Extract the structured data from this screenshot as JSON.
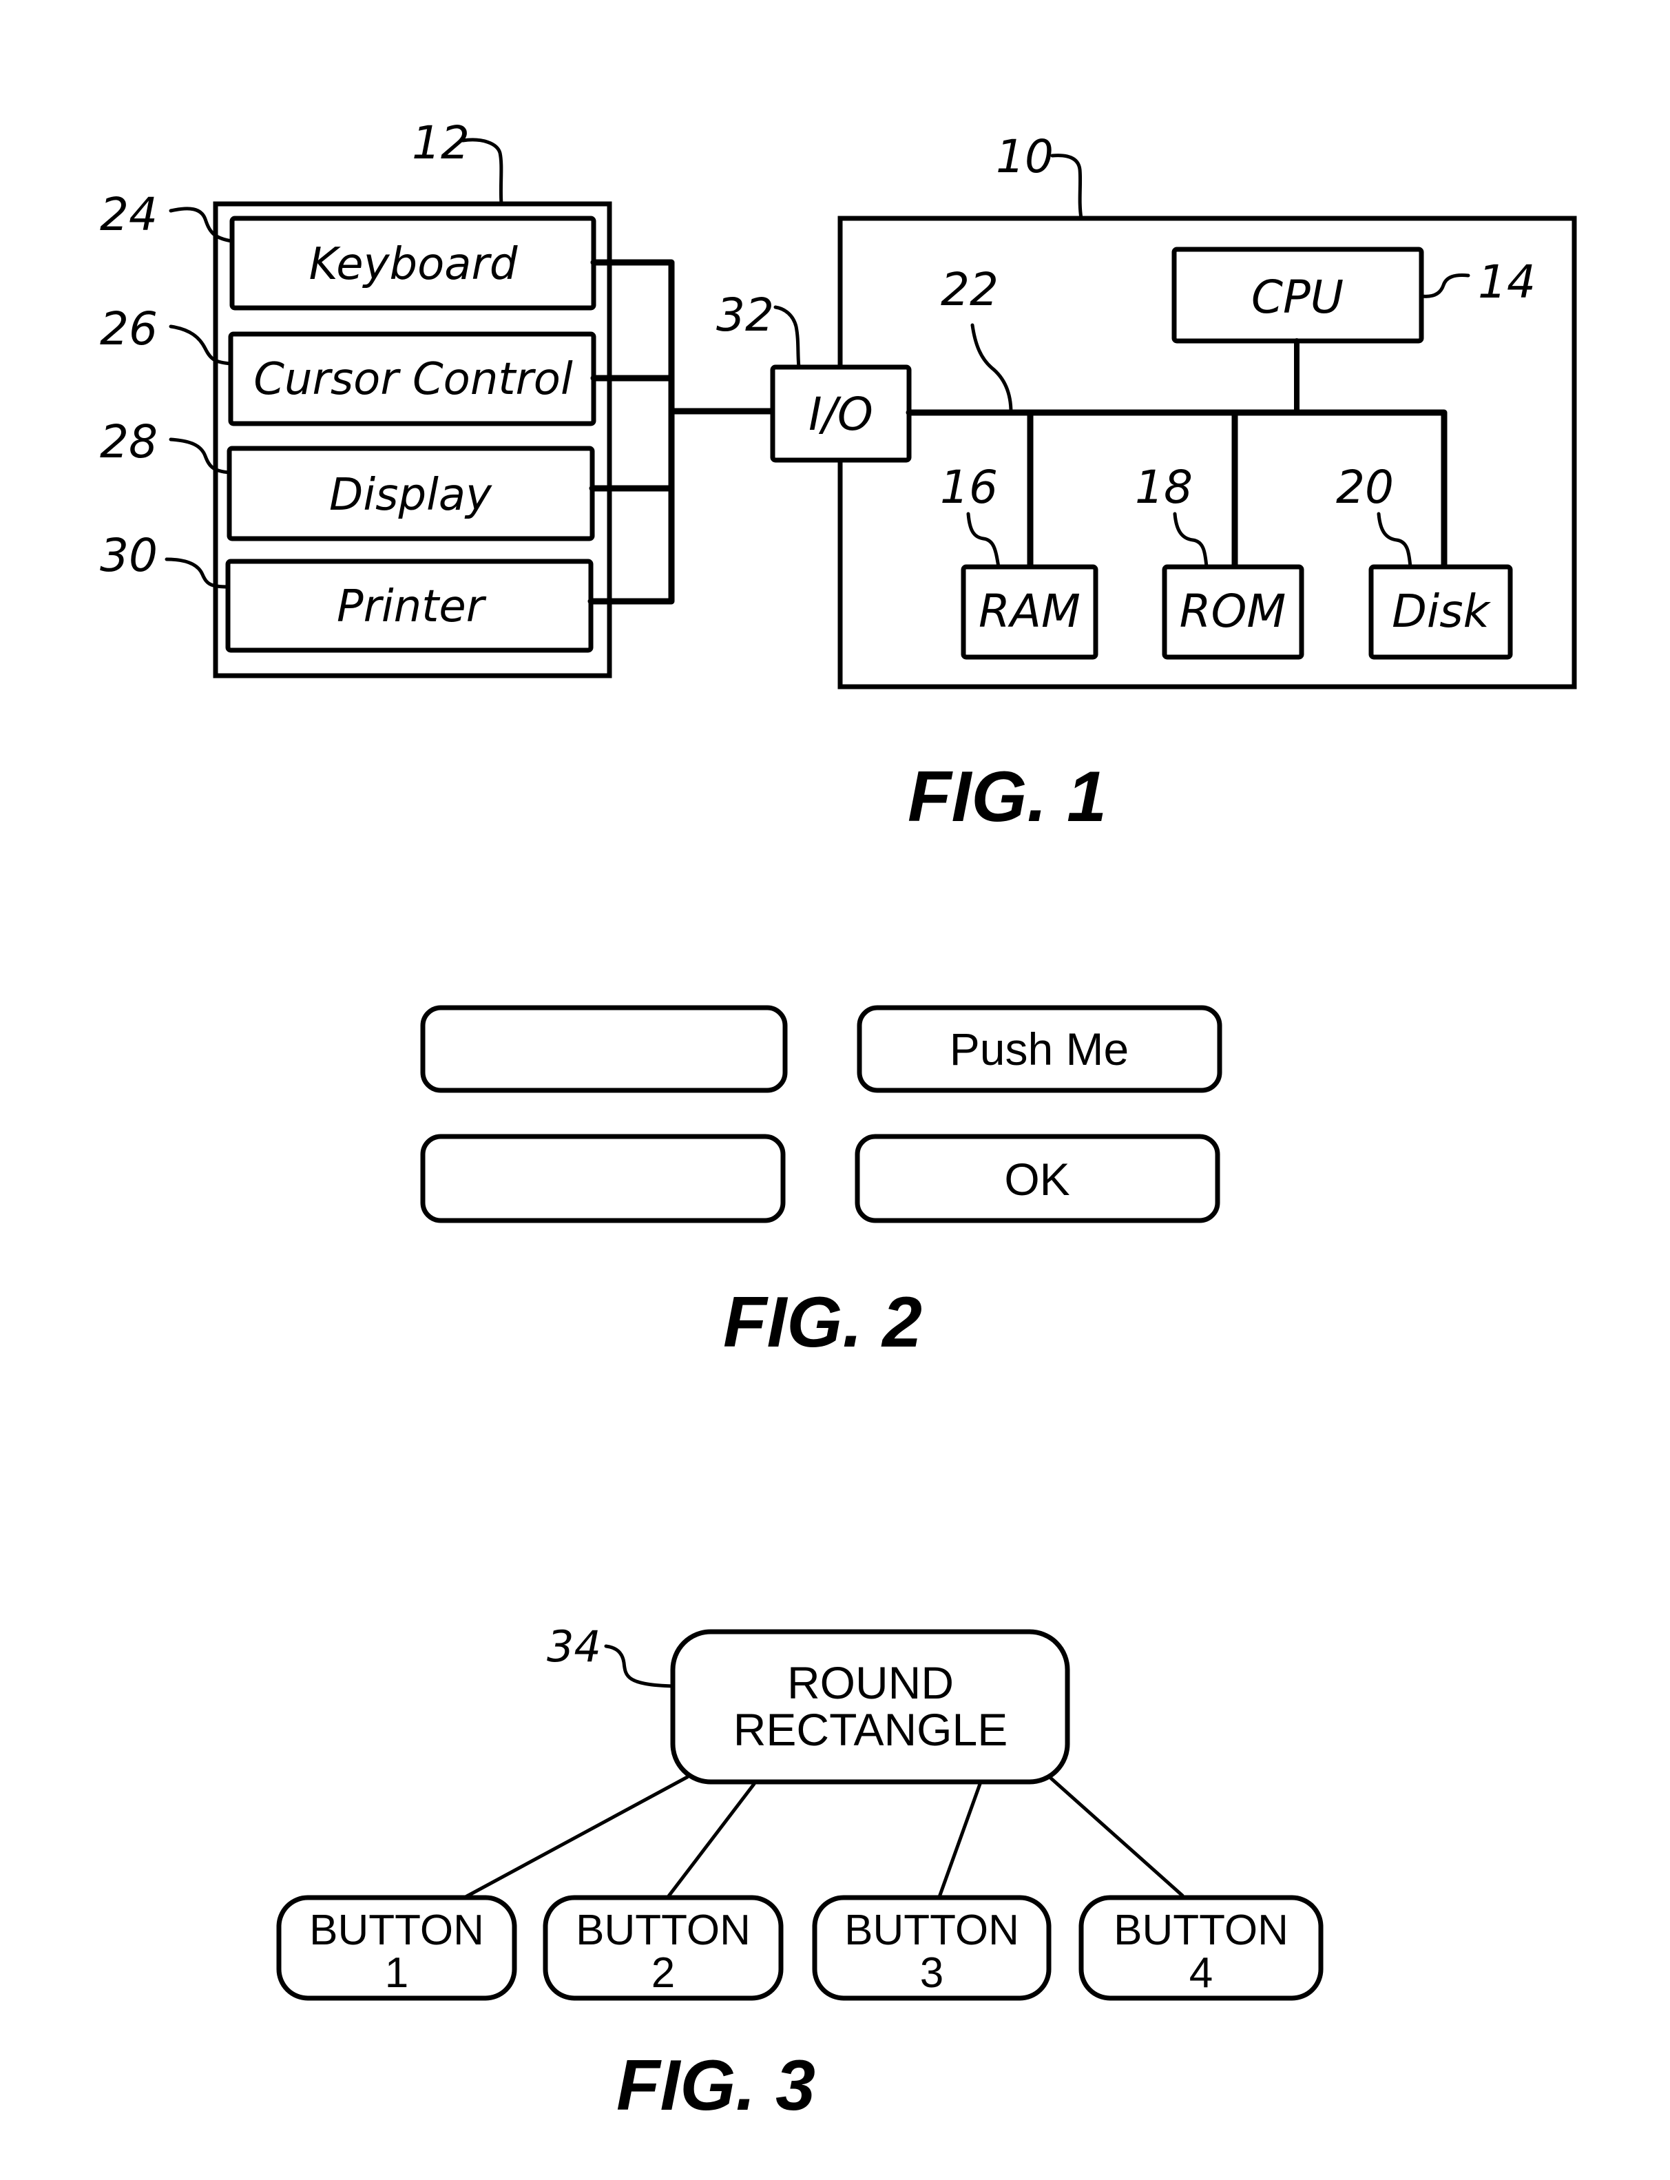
{
  "page": {
    "type": "patent drawing sheet",
    "background": "#ffffff",
    "ink": "#000000"
  },
  "fig1": {
    "caption": "FIG. 1",
    "peripherals": {
      "ref": "12",
      "items": [
        {
          "ref": "24",
          "label": "Keyboard"
        },
        {
          "ref": "26",
          "label": "Cursor Control"
        },
        {
          "ref": "28",
          "label": "Display"
        },
        {
          "ref": "30",
          "label": "Printer"
        }
      ]
    },
    "io": {
      "ref": "32",
      "label": "I/O"
    },
    "computer": {
      "ref": "10",
      "bus_ref": "22",
      "cpu": {
        "ref": "14",
        "label": "CPU"
      },
      "memory": [
        {
          "ref": "16",
          "label": "RAM"
        },
        {
          "ref": "18",
          "label": "ROM"
        },
        {
          "ref": "20",
          "label": "Disk"
        }
      ]
    }
  },
  "fig2": {
    "caption": "FIG. 2",
    "buttons": [
      {
        "label": ""
      },
      {
        "label": "Push Me"
      },
      {
        "label": ""
      },
      {
        "label": "OK"
      }
    ]
  },
  "fig3": {
    "caption": "FIG. 3",
    "parent": {
      "ref": "34",
      "line1": "ROUND",
      "line2": "RECTANGLE"
    },
    "children": [
      {
        "line1": "BUTTON",
        "line2": "1"
      },
      {
        "line1": "BUTTON",
        "line2": "2"
      },
      {
        "line1": "BUTTON",
        "line2": "3"
      },
      {
        "line1": "BUTTON",
        "line2": "4"
      }
    ]
  }
}
